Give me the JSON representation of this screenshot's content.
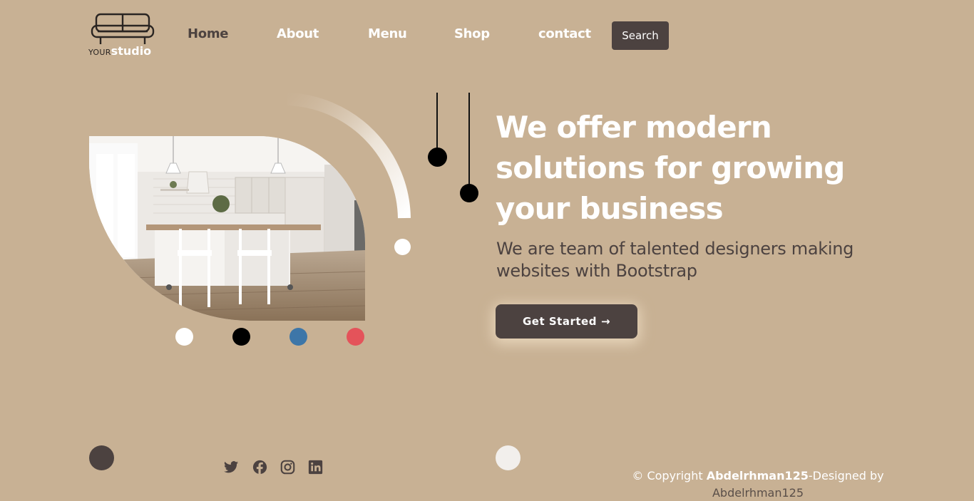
{
  "brand": {
    "logo_your": "YOUR",
    "logo_studio": "studio"
  },
  "nav": {
    "items": [
      {
        "label": "Home"
      },
      {
        "label": "About"
      },
      {
        "label": "Menu"
      },
      {
        "label": "Shop"
      },
      {
        "label": "contact"
      }
    ],
    "search_label": "Search"
  },
  "hero": {
    "title": "We offer modern solutions for growing your business",
    "subtitle": "We are team of talented designers making websites with Bootstrap",
    "cta_label": "Get Started",
    "cta_icon": "arrow-right-icon",
    "image": "kitchen-interior-photo",
    "color_swatches": [
      "#ffffff",
      "#000000",
      "#3d76a8",
      "#e4535a"
    ]
  },
  "footer": {
    "social_icons": [
      "twitter-icon",
      "facebook-icon",
      "instagram-icon",
      "linkedin-icon"
    ],
    "copyright_prefix": "© Copyright ",
    "copyright_name": "Abdelrhman125",
    "copyright_suffix": "-Designed by",
    "designer": "Abdelrhman125"
  },
  "colors": {
    "background": "#c8b194",
    "primary": "#4c4240",
    "text_light": "#ffffff"
  }
}
